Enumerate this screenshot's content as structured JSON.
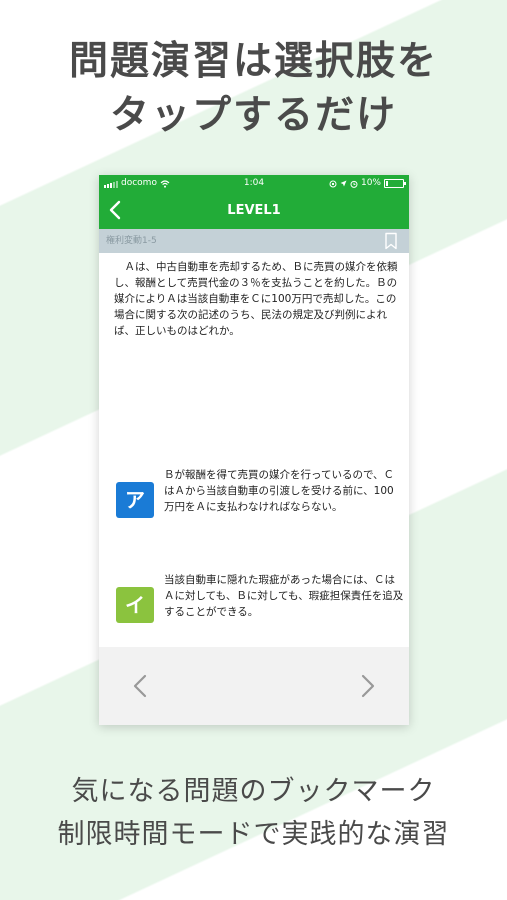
{
  "promo": {
    "headline_line1": "問題演習は選択肢を",
    "headline_line2": "タップするだけ",
    "footer_line1": "気になる問題のブックマーク",
    "footer_line2": "制限時間モードで実践的な演習"
  },
  "status_bar": {
    "carrier": "docomo",
    "time": "1:04",
    "battery_label": "10%",
    "battery_level": 0.1
  },
  "nav": {
    "title": "LEVEL1"
  },
  "subheader": {
    "label": "権利変動1-5"
  },
  "question": {
    "text": "Ａは、中古自動車を売却するため、Ｂに売買の媒介を依頼し、報酬として売買代金の３％を支払うことを約した。Ｂの媒介によりＡは当該自動車をＣに100万円で売却した。この場合に関する次の記述のうち、民法の規定及び判例によれば、正しいものはどれか。"
  },
  "choices": [
    {
      "badge": "ア",
      "text": "Ｂが報酬を得て売買の媒介を行っているので、ＣはＡから当該自動車の引渡しを受ける前に、100万円をＡに支払わなければならない。"
    },
    {
      "badge": "イ",
      "text": "当該自動車に隠れた瑕疵があった場合には、ＣはＡに対しても、Ｂに対しても、瑕疵担保責任を追及することができる。"
    }
  ],
  "colors": {
    "accent_green": "#22ac38",
    "subheader_bg": "#c4d1d7",
    "badge_blue": "#1a7bd6",
    "badge_lime": "#8bc33e",
    "promo_text": "#4a4a4a"
  },
  "icons": {
    "back": "chevron-left-icon",
    "bookmark": "bookmark-icon",
    "prev": "chevron-left-icon",
    "next": "chevron-right-icon",
    "wifi": "wifi-icon",
    "alarm": "alarm-icon",
    "location": "location-arrow-icon",
    "rotation_lock": "rotation-lock-icon"
  }
}
